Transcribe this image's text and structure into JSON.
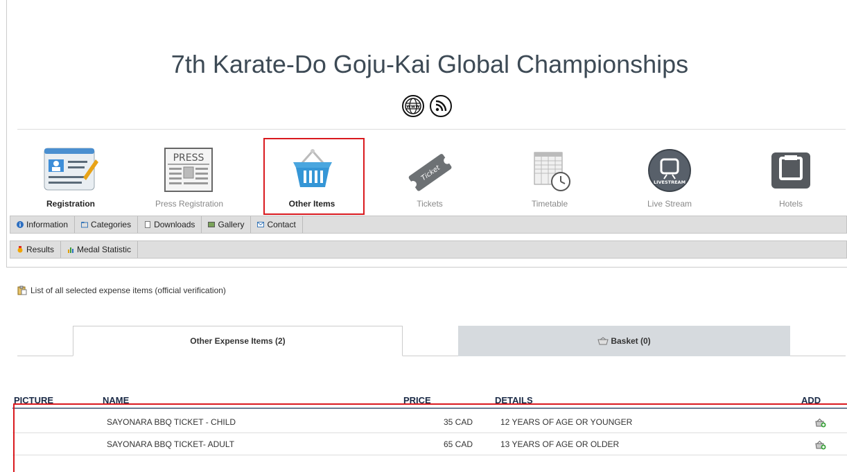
{
  "header": {
    "title": "7th Karate-Do Goju-Kai Global Championships"
  },
  "title_icons": [
    {
      "name": "globe-www-icon",
      "text": "www"
    },
    {
      "name": "rss-icon",
      "text": ""
    }
  ],
  "nav": [
    {
      "label": "Registration",
      "state": "bold"
    },
    {
      "label": "Press Registration",
      "state": "normal"
    },
    {
      "label": "Other Items",
      "state": "active"
    },
    {
      "label": "Tickets",
      "state": "normal"
    },
    {
      "label": "Timetable",
      "state": "normal"
    },
    {
      "label": "Live Stream",
      "state": "normal"
    },
    {
      "label": "Hotels",
      "state": "normal"
    }
  ],
  "press_icon_text": "PRESS",
  "ticket_icon_text": "Ticket",
  "livestream_icon_text": "LIVESTREAM",
  "subnav1": [
    {
      "label": "Information",
      "icon": "info-icon"
    },
    {
      "label": "Categories",
      "icon": "folder-icon"
    },
    {
      "label": "Downloads",
      "icon": "document-icon"
    },
    {
      "label": "Gallery",
      "icon": "image-icon"
    },
    {
      "label": "Contact",
      "icon": "mail-icon"
    }
  ],
  "subnav2": [
    {
      "label": "Results",
      "icon": "medal-icon"
    },
    {
      "label": "Medal Statistic",
      "icon": "bar-chart-icon"
    }
  ],
  "note": "List of all selected expense items (official verification)",
  "tabs": [
    {
      "label": "Other Expense Items (2)",
      "active": true
    },
    {
      "label": "Basket (0)",
      "active": false
    }
  ],
  "table": {
    "headers": {
      "picture": "PICTURE",
      "name": "NAME",
      "price": "PRICE",
      "details": "DETAILS",
      "add": "ADD"
    },
    "rows": [
      {
        "name": "SAYONARA BBQ TICKET - CHILD",
        "price": "35 CAD",
        "details": "12 YEARS OF AGE OR YOUNGER"
      },
      {
        "name": "SAYONARA BBQ TICKET- ADULT",
        "price": "65 CAD",
        "details": "13 YEARS OF AGE OR OLDER"
      }
    ]
  },
  "colors": {
    "highlight": "#d9191e",
    "header_text": "#1a2a46",
    "title": "#3d4a55"
  }
}
